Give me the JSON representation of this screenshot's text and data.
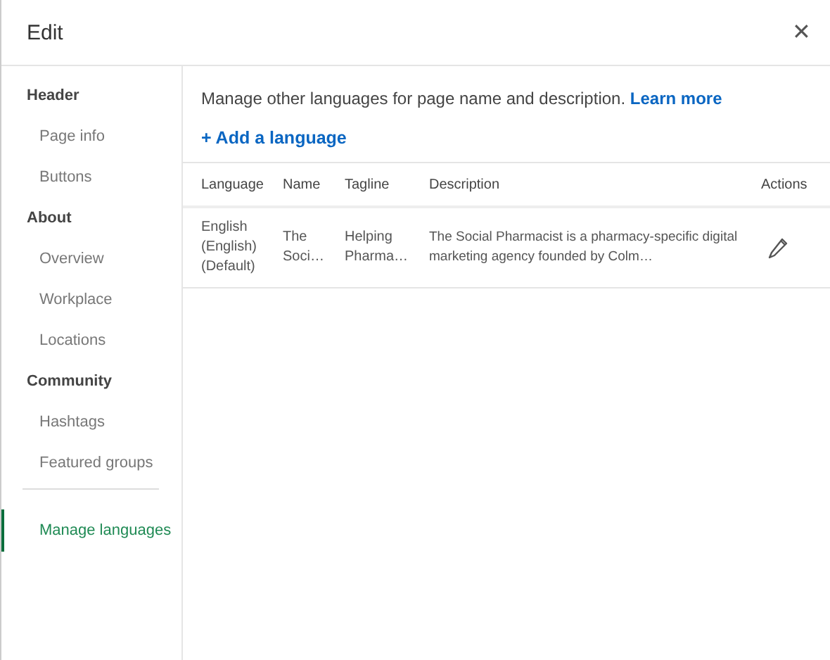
{
  "dialog": {
    "title": "Edit",
    "close": "✕"
  },
  "sidebar": {
    "groups": [
      {
        "title": "Header",
        "items": [
          {
            "label": "Page info",
            "selected": false
          },
          {
            "label": "Buttons",
            "selected": false
          }
        ]
      },
      {
        "title": "About",
        "items": [
          {
            "label": "Overview",
            "selected": false
          },
          {
            "label": "Workplace",
            "selected": false
          },
          {
            "label": "Locations",
            "selected": false
          }
        ]
      },
      {
        "title": "Community",
        "items": [
          {
            "label": "Hashtags",
            "selected": false
          },
          {
            "label": "Featured groups",
            "selected": false
          }
        ]
      },
      {
        "items": [
          {
            "label": "Manage languages",
            "selected": true
          }
        ]
      }
    ]
  },
  "content": {
    "intro": "Manage other languages for page name and description.",
    "learn_more": "Learn more",
    "add_button": "+ Add a language",
    "table": {
      "columns": [
        "Language",
        "Name",
        "Tagline",
        "Description",
        "Actions"
      ],
      "rows": [
        {
          "cells": [
            "English (English) (Default)",
            "The Soci…",
            "Helping Pharma…",
            "The Social Pharmacist is a pharmacy-specific digital marketing agency founded by Colm…"
          ]
        }
      ]
    }
  }
}
